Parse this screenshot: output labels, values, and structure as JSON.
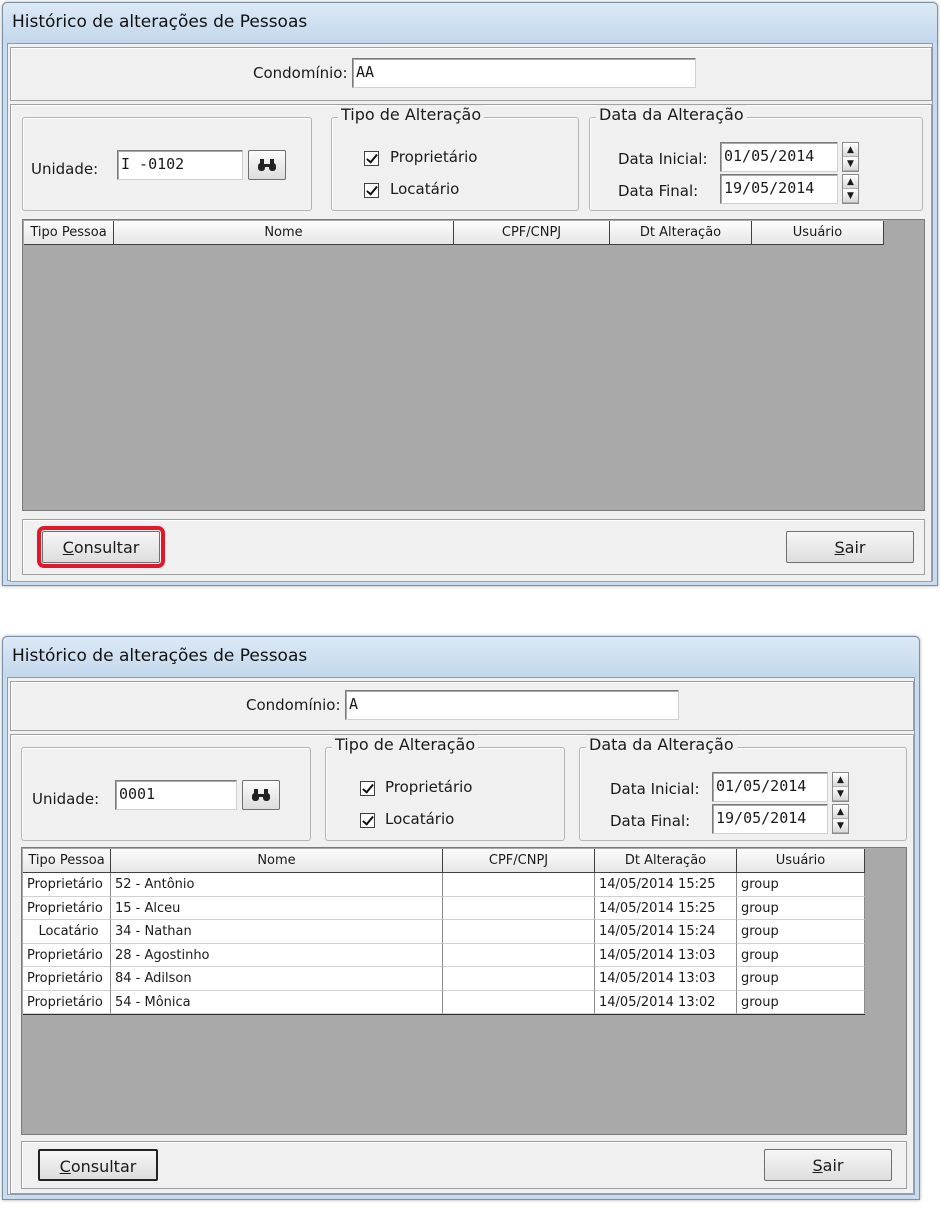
{
  "windows": [
    {
      "title": "Histórico de alterações de Pessoas",
      "condominio_label": "Condomínio:",
      "condominio_value": "AA",
      "unidade_label": "Unidade:",
      "unidade_value": "I -0102",
      "tipo_group": "Tipo de Alteração",
      "proprietario_label": "Proprietário",
      "locatario_label": "Locatário",
      "data_group": "Data da Alteração",
      "data_inicial_label": "Data Inicial:",
      "data_inicial_value": "01/05/2014",
      "data_final_label": "Data Final:",
      "data_final_value": "19/05/2014",
      "columns": [
        "Tipo Pessoa",
        "Nome",
        "CPF/CNPJ",
        "Dt Alteração",
        "Usuário"
      ],
      "rows": [],
      "consultar_first": "C",
      "consultar_rest": "onsultar",
      "sair_first": "S",
      "sair_rest": "air"
    },
    {
      "title": "Histórico de alterações de Pessoas",
      "condominio_label": "Condomínio:",
      "condominio_value": "A",
      "unidade_label": "Unidade:",
      "unidade_value": "0001",
      "tipo_group": "Tipo de Alteração",
      "proprietario_label": "Proprietário",
      "locatario_label": "Locatário",
      "data_group": "Data da Alteração",
      "data_inicial_label": "Data Inicial:",
      "data_inicial_value": "01/05/2014",
      "data_final_label": "Data Final:",
      "data_final_value": "19/05/2014",
      "columns": [
        "Tipo Pessoa",
        "Nome",
        "CPF/CNPJ",
        "Dt Alteração",
        "Usuário"
      ],
      "rows": [
        {
          "tipo": "Proprietário",
          "nome": "52 - Antônio",
          "cpf": "",
          "dt": "14/05/2014 15:25",
          "usuario": "group"
        },
        {
          "tipo": "Proprietário",
          "nome": "15 - Alceu",
          "cpf": "",
          "dt": "14/05/2014 15:25",
          "usuario": "group"
        },
        {
          "tipo": "Locatário",
          "nome": "34 - Nathan",
          "cpf": "",
          "dt": "14/05/2014 15:24",
          "usuario": "group"
        },
        {
          "tipo": "Proprietário",
          "nome": "28 - Agostinho",
          "cpf": "",
          "dt": "14/05/2014 13:03",
          "usuario": "group"
        },
        {
          "tipo": "Proprietário",
          "nome": "84 - Adilson",
          "cpf": "",
          "dt": "14/05/2014 13:03",
          "usuario": "group"
        },
        {
          "tipo": "Proprietário",
          "nome": "54 - Mônica",
          "cpf": "",
          "dt": "14/05/2014 13:02",
          "usuario": "group"
        }
      ],
      "consultar_first": "C",
      "consultar_rest": "onsultar",
      "sair_first": "S",
      "sair_rest": "air"
    }
  ],
  "colors": {
    "highlight": "#e0182a",
    "grid_bg": "#a9a9a9"
  },
  "icons": {
    "search": "binoculars-icon"
  }
}
